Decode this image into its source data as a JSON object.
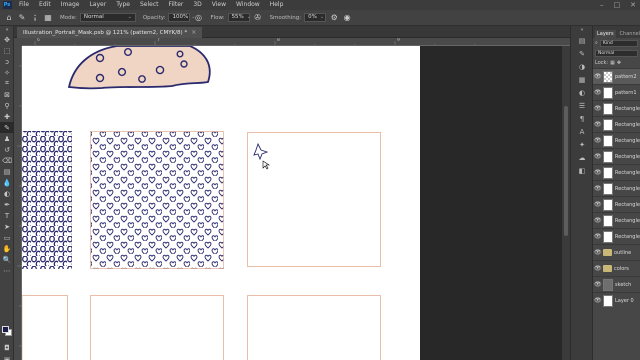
{
  "app": {
    "logo": "Ps"
  },
  "menu": [
    "File",
    "Edit",
    "Image",
    "Layer",
    "Type",
    "Select",
    "Filter",
    "3D",
    "View",
    "Window",
    "Help"
  ],
  "window_controls": [
    "–",
    "□",
    "✕"
  ],
  "options": {
    "brush_size": "9",
    "mode_label": "Mode:",
    "mode_value": "Normal",
    "opacity_label": "Opacity:",
    "opacity_value": "100%",
    "flow_label": "Flow:",
    "flow_value": "55%",
    "smoothing_label": "Smoothing:",
    "smoothing_value": "0%"
  },
  "document": {
    "tab_title": "Illustration_Portrait_Mask.psb @ 121% (pattern2, CMYK/8) *",
    "close": "×"
  },
  "ruler": {
    "labels": [
      "6",
      "7",
      "8",
      "9"
    ]
  },
  "panels": {
    "tabs": [
      "Layers",
      "Channels"
    ],
    "filter_label": "Kind",
    "blend_mode": "Normal",
    "lock_label": "Lock:",
    "layers": [
      {
        "name": "pattern2",
        "type": "transparent",
        "selected": true
      },
      {
        "name": "pattern1",
        "type": "white"
      },
      {
        "name": "Rectangle",
        "type": "white"
      },
      {
        "name": "Rectangle",
        "type": "white"
      },
      {
        "name": "Rectangle",
        "type": "white"
      },
      {
        "name": "Rectangle",
        "type": "white"
      },
      {
        "name": "Rectangle",
        "type": "white"
      },
      {
        "name": "Rectangle",
        "type": "white"
      },
      {
        "name": "Rectangle",
        "type": "white"
      },
      {
        "name": "Rectangle",
        "type": "white"
      },
      {
        "name": "Rectangle",
        "type": "white"
      },
      {
        "name": "outline",
        "type": "folder"
      },
      {
        "name": "colors",
        "type": "folder"
      },
      {
        "name": "sketch",
        "type": "swatch"
      },
      {
        "name": "Layer 0",
        "type": "white"
      }
    ]
  },
  "colors": {
    "foreground": "#1c1f4d",
    "background": "#ffffff",
    "pattern_ink": "#2a2a6e",
    "frame_stroke": "#e8b8a0",
    "skin": "#f0d4c4"
  }
}
